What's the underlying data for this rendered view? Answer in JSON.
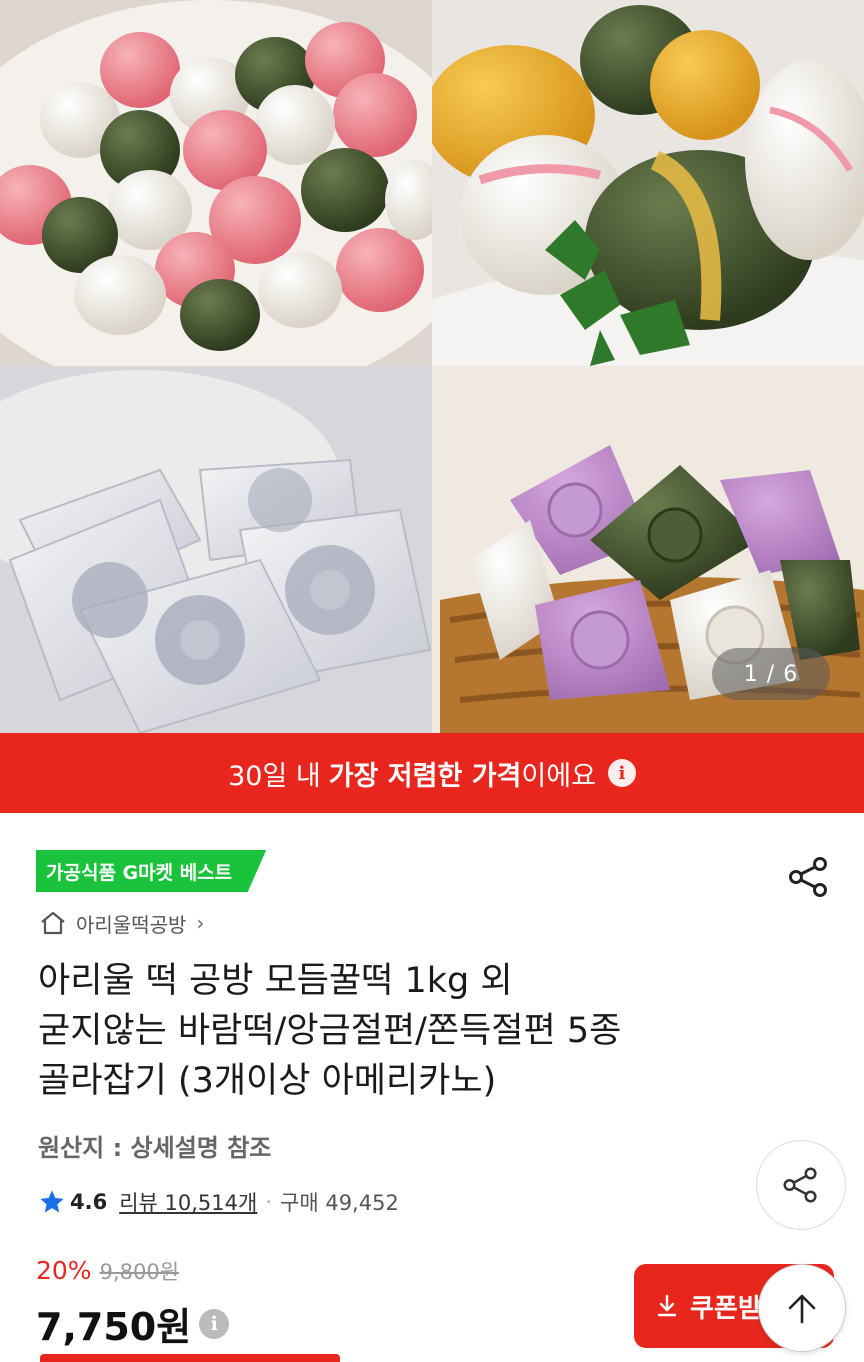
{
  "gallery": {
    "counter": "1 / 6",
    "photo_alts": [
      "colorful songpyeon rice cakes",
      "layered rice cakes with parsley",
      "translucent white patterned rice cakes",
      "purple green white rice cakes in basket"
    ],
    "colors": {
      "pink": "#ec7d86",
      "white_rc": "#f1ede6",
      "green": "#3e4f2c",
      "yellow": "#e8aa24",
      "purple": "#b784c0",
      "basket": "#b5772f"
    }
  },
  "banner": {
    "pre": "30일 내",
    "bold": "가장 저렴한 가격",
    "post": "이에요",
    "info_icon": "info-icon",
    "color": "#e8261d"
  },
  "badge": {
    "label": "가공식품 G마켓 베스트",
    "color": "#19c33b"
  },
  "shop": {
    "name": "아리울떡공방",
    "icon": "home-icon"
  },
  "product": {
    "title_lines": [
      "아리울 떡 공방 모듬꿀떡 1kg 외",
      "굳지않는 바람떡/앙금절편/쫀득절편 5종",
      "골라잡기 (3개이상 아메리카노)"
    ],
    "origin": "원산지 : 상세설명 참조"
  },
  "rating": {
    "score": "4.6",
    "reviews": "리뷰 10,514개",
    "separator": "·",
    "purchases": "구매 49,452"
  },
  "price": {
    "discount_rate": "20%",
    "original": "9,800원",
    "final": "7,750원"
  },
  "coupon": {
    "label": "쿠폰받"
  }
}
